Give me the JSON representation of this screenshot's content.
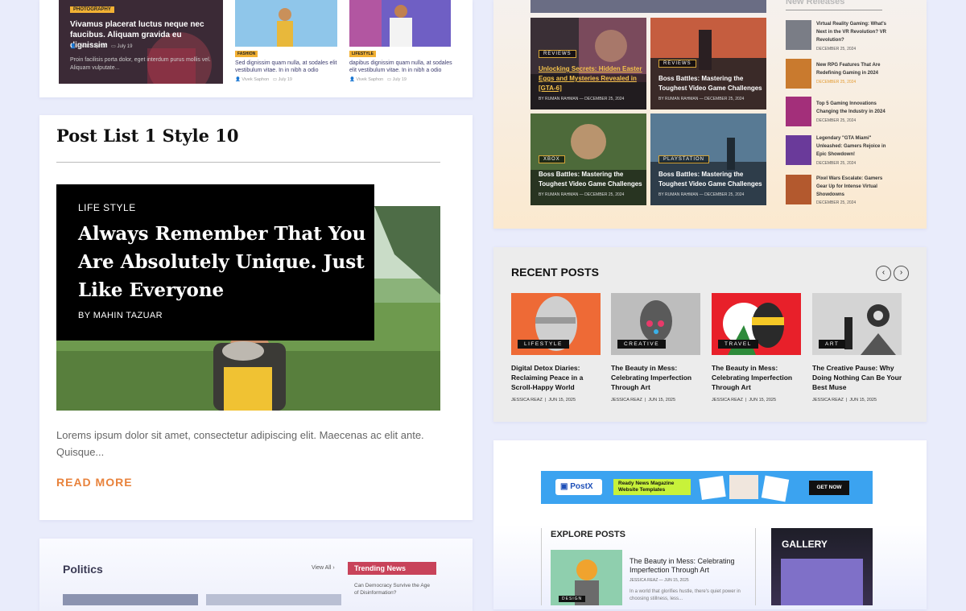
{
  "top_grid": {
    "featured": {
      "tag": "PHOTOGRAPHY",
      "title": "Vivamus placerat luctus neque nec faucibus. Aliquam gravida eu dignissim",
      "excerpt": "Proin facilisis porta dolor, eget interdum purus mollis vel. Aliquam vulputate..."
    },
    "cards": [
      {
        "tag": "FASHION",
        "title": "Sed dignissim quam nulla, at sodales elit vestibulum vitae. In in nibh a odio",
        "author": "Vivek Saphon",
        "date": "July 19"
      },
      {
        "tag": "LIFESTYLE",
        "title": "dapibus dignissim quam nulla, at sodales elit vestibulum vitae. In in nibh a odio",
        "author": "Vivek Saphon",
        "date": "July 19"
      }
    ],
    "featured_author": "Vivek Saphon",
    "featured_date": "July 19"
  },
  "post_list": {
    "heading": "Post List 1 Style 10",
    "category": "LIFE STYLE",
    "title": "Always Remember That You Are Absolutely Unique. Just Like Everyone",
    "byline": "BY  MAHIN TAZUAR",
    "excerpt": "Lorems ipsum dolor sit amet, consectetur adipiscing elit. Maecenas ac elit ante. Quisque...",
    "read_more": "READ MORE"
  },
  "politics": {
    "heading": "Politics",
    "view_all": "View All  ›",
    "trending_heading": "Trending News",
    "trending_item": "Can Democracy Survive the Age of Disinformation?"
  },
  "gaming": {
    "tiles": [
      {
        "tag": "REVIEWS",
        "title": "Unlocking Secrets: Hidden Easter Eggs and Mysteries Revealed in [GTA-6]",
        "meta": "BY RUMAN RAHMAN  —  DECEMBER 25, 2024"
      },
      {
        "tag": "REVIEWS",
        "title": "Boss Battles: Mastering the Toughest Video Game Challenges",
        "meta": "BY RUMAN RAHMAN  —  DECEMBER 25, 2024"
      },
      {
        "tag": "XBOX",
        "title": "Boss Battles: Mastering the Toughest Video Game Challenges",
        "meta": "BY RUMAN RAHMAN  —  DECEMBER 25, 2024"
      },
      {
        "tag": "PLAYSTATION",
        "title": "Boss Battles: Mastering the Toughest Video Game Challenges",
        "meta": "BY RUMAN RAHMAN  —  DECEMBER 25, 2024"
      }
    ],
    "new_releases_heading": "New Releases",
    "new_releases": [
      {
        "title": "Virtual Reality Gaming: What's Next in the VR Revolution? VR Revolution?",
        "date": "DECEMBER 25, 2024"
      },
      {
        "title": "New RPG Features That Are Redefining Gaming in 2024",
        "date": "DECEMBER 25, 2024"
      },
      {
        "title": "Top 5 Gaming Innovations Changing the Industry in 2024",
        "date": "DECEMBER 25, 2024"
      },
      {
        "title": "Legendary \"GTA Miami\" Unleashed: Gamers Rejoice in Epic Showdown!",
        "date": "DECEMBER 25, 2024"
      },
      {
        "title": "Pixel Wars Escalate: Gamers Gear Up for Intense Virtual Showdowns",
        "date": "DECEMBER 25, 2024"
      }
    ]
  },
  "recent_posts": {
    "heading": "RECENT POSTS",
    "prev": "‹",
    "next": "›",
    "items": [
      {
        "tag": "LIFESTYLE",
        "title": "Digital Detox Diaries: Reclaiming Peace in a Scroll-Happy World",
        "author": "JESSICA REAZ",
        "date": "JUN 15, 2025"
      },
      {
        "tag": "CREATIVE",
        "title": "The Beauty in Mess: Celebrating Imperfection Through Art",
        "author": "JESSICA REAZ",
        "date": "JUN 15, 2025"
      },
      {
        "tag": "TRAVEL",
        "title": "The Beauty in Mess: Celebrating Imperfection Through Art",
        "author": "JESSICA REAZ",
        "date": "JUN 15, 2025"
      },
      {
        "tag": "ART",
        "title": "The Creative Pause: Why Doing Nothing Can Be Your Best Muse",
        "author": "JESSICA REAZ",
        "date": "JUN 15, 2025"
      }
    ]
  },
  "postx": {
    "logo": "PostX",
    "banner_text": "Ready News Magazine Website Templates",
    "cta": "GET NOW",
    "explore_heading": "EXPLORE POSTS",
    "explore_item_title": "The Beauty in Mess: Celebrating Imperfection Through Art",
    "explore_item_meta": "JESSICA REAZ  —  JUN 15, 2025",
    "explore_item_excerpt": "In a world that glorifies hustle, there's quiet power in choosing stillness, less...",
    "explore_tag": "DESIGN",
    "gallery_heading": "GALLERY"
  }
}
